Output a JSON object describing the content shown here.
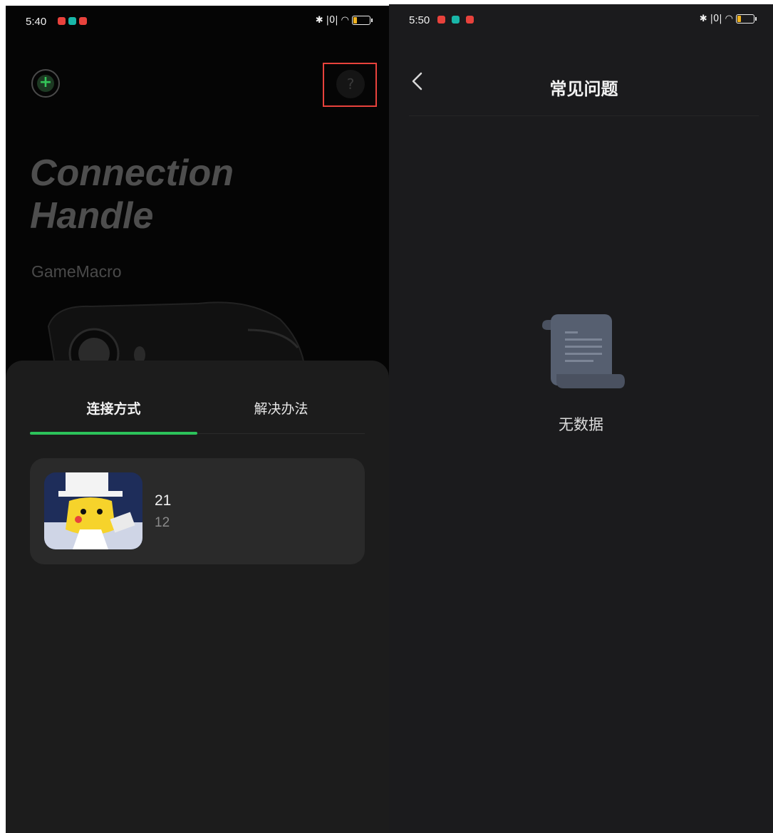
{
  "left": {
    "status_bar": {
      "time": "5:40",
      "notifications": [
        "#e8423c",
        "#19b6a8",
        "#e8423c"
      ]
    },
    "hero": {
      "title_line1": "Connection",
      "title_line2": "Handle",
      "subtitle": "GameMacro"
    },
    "tabs": [
      {
        "label": "连接方式",
        "active": true
      },
      {
        "label": "解决办法",
        "active": false
      }
    ],
    "device_card": {
      "title": "21",
      "subtitle": "12"
    },
    "help_icon": "?",
    "add_icon": "+",
    "accent_color": "#2cc25a",
    "highlight_color": "#e8423c"
  },
  "right": {
    "status_bar": {
      "time": "5:50",
      "notifications": [
        "#e8423c",
        "#19b6a8",
        "#e8423c"
      ]
    },
    "nav": {
      "title": "常见问题"
    },
    "empty_state": {
      "text": "无数据",
      "icon": "scroll-document-icon"
    }
  }
}
